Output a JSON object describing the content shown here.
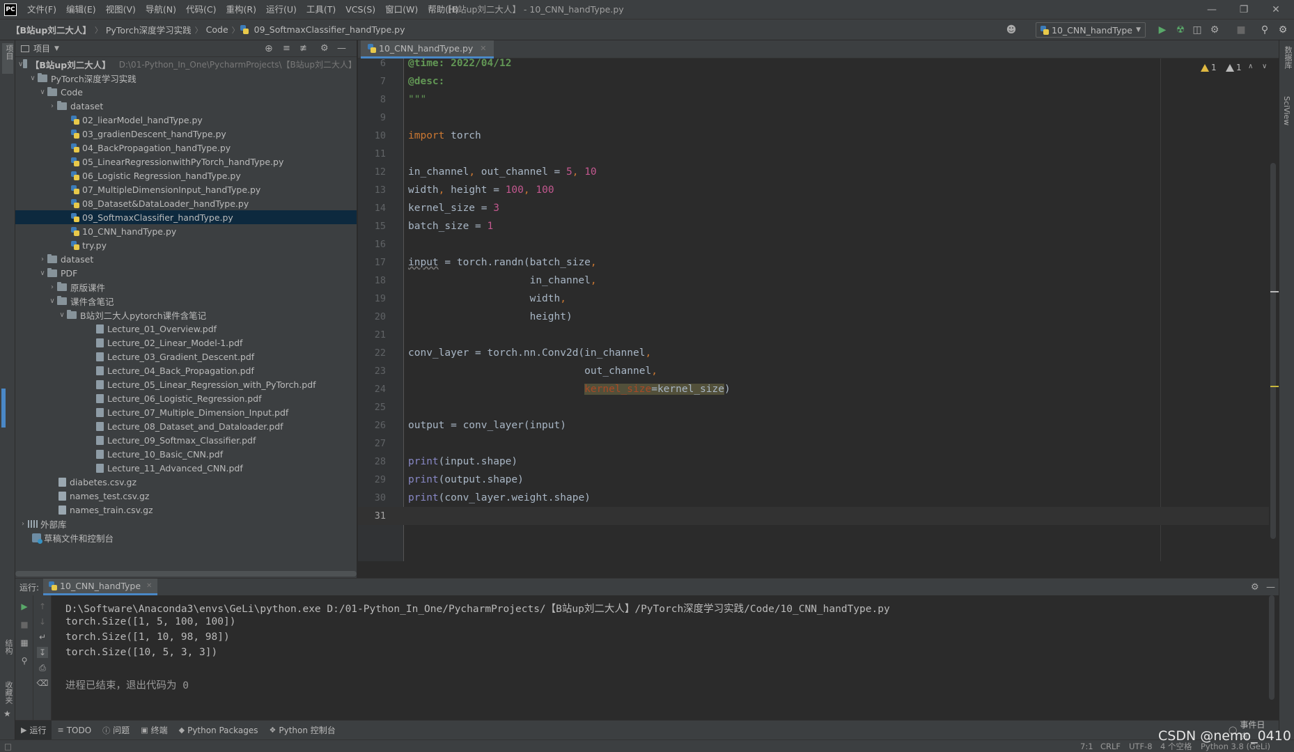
{
  "menubar": {
    "logo": "PC",
    "items": [
      "文件(F)",
      "编辑(E)",
      "视图(V)",
      "导航(N)",
      "代码(C)",
      "重构(R)",
      "运行(U)",
      "工具(T)",
      "VCS(S)",
      "窗口(W)",
      "帮助(H)"
    ],
    "window_title": "【B站up刘二大人】 - 10_CNN_handType.py"
  },
  "navbar": {
    "breadcrumbs": [
      "【B站up刘二大人】",
      "PyTorch深度学习实践",
      "Code",
      "09_SoftmaxClassifier_handType.py"
    ],
    "run_config": "10_CNN_handType"
  },
  "left_strip": {
    "project_label": "项目",
    "structure_label": "结构",
    "favorites_label": "收藏夹"
  },
  "right_strip": {
    "database_label": "数据库",
    "sciview_label": "SciView"
  },
  "project": {
    "header": "项目",
    "root": {
      "name": "【B站up刘二大人】",
      "path": "D:\\01-Python_In_One\\PycharmProjects\\【B站up刘二大人】"
    },
    "items": [
      {
        "label": "PyTorch深度学习实践"
      },
      {
        "label": "Code"
      },
      {
        "label": "dataset"
      },
      {
        "label": "02_liearModel_handType.py"
      },
      {
        "label": "03_gradienDescent_handType.py"
      },
      {
        "label": "04_BackPropagation_handType.py"
      },
      {
        "label": "05_LinearRegressionwithPyTorch_handType.py"
      },
      {
        "label": "06_Logistic Regression_handType.py"
      },
      {
        "label": "07_MultipleDimensionInput_handType.py"
      },
      {
        "label": "08_Dataset&DataLoader_handType.py"
      },
      {
        "label": "09_SoftmaxClassifier_handType.py"
      },
      {
        "label": "10_CNN_handType.py"
      },
      {
        "label": "try.py"
      },
      {
        "label": "dataset"
      },
      {
        "label": "PDF"
      },
      {
        "label": "原版课件"
      },
      {
        "label": "课件含笔记"
      },
      {
        "label": "B站刘二大人pytorch课件含笔记"
      },
      {
        "label": "Lecture_01_Overview.pdf"
      },
      {
        "label": "Lecture_02_Linear_Model-1.pdf"
      },
      {
        "label": "Lecture_03_Gradient_Descent.pdf"
      },
      {
        "label": "Lecture_04_Back_Propagation.pdf"
      },
      {
        "label": "Lecture_05_Linear_Regression_with_PyTorch.pdf"
      },
      {
        "label": "Lecture_06_Logistic_Regression.pdf"
      },
      {
        "label": "Lecture_07_Multiple_Dimension_Input.pdf"
      },
      {
        "label": "Lecture_08_Dataset_and_Dataloader.pdf"
      },
      {
        "label": "Lecture_09_Softmax_Classifier.pdf"
      },
      {
        "label": "Lecture_10_Basic_CNN.pdf"
      },
      {
        "label": "Lecture_11_Advanced_CNN.pdf"
      },
      {
        "label": "diabetes.csv.gz"
      },
      {
        "label": "names_test.csv.gz"
      },
      {
        "label": "names_train.csv.gz"
      },
      {
        "label": "外部库"
      },
      {
        "label": "草稿文件和控制台"
      }
    ]
  },
  "editor": {
    "tab": "10_CNN_handType.py",
    "warnings": {
      "count_a": "1",
      "count_b": "1"
    },
    "line_numbers": [
      "6",
      "7",
      "8",
      "9",
      "10",
      "11",
      "12",
      "13",
      "14",
      "15",
      "16",
      "17",
      "18",
      "19",
      "20",
      "21",
      "22",
      "23",
      "24",
      "25",
      "26",
      "27",
      "28",
      "29",
      "30",
      "31"
    ],
    "code": {
      "l6_tag": "@time:",
      "l6_val": " 2022/04/12",
      "l7_tag": "@desc:",
      "l8": "\"\"\"",
      "l10_kw": "import",
      "l10_rest": " torch",
      "l12_a": "in_channel",
      "l12_c1": ", ",
      "l12_b": "out_channel = ",
      "l12_n1": "5",
      "l12_c2": ", ",
      "l12_n2": "10",
      "l13_a": "width",
      "l13_c1": ", ",
      "l13_b": "height = ",
      "l13_n1": "100",
      "l13_c2": ", ",
      "l13_n2": "100",
      "l14_a": "kernel_size = ",
      "l14_n": "3",
      "l15_a": "batch_size = ",
      "l15_n": "1",
      "l17_a": "input",
      "l17_b": " = torch.randn(batch_size",
      "l17_c": ",",
      "l18_a": "                    in_channel",
      "l18_c": ",",
      "l19_a": "                    width",
      "l19_c": ",",
      "l20_a": "                    height)",
      "l22_a": "conv_layer = torch.nn.Conv2d(in_channel",
      "l22_c": ",",
      "l23_a": "                             out_channel",
      "l23_c": ",",
      "l24_pad": "                             ",
      "l24_kw": "kernel_size",
      "l24_eq": "=",
      "l24_val": "kernel_size",
      "l24_close": ")",
      "l26": "output = conv_layer(input)",
      "l28_fn": "print",
      "l28_rest": "(input.shape)",
      "l29_fn": "print",
      "l29_rest": "(output.shape)",
      "l30_fn": "print",
      "l30_rest": "(conv_layer.weight.shape)"
    }
  },
  "run": {
    "label": "运行:",
    "tab": "10_CNN_handType",
    "output": [
      "D:\\Software\\Anaconda3\\envs\\GeLi\\python.exe D:/01-Python_In_One/PycharmProjects/【B站up刘二大人】/PyTorch深度学习实践/Code/10_CNN_handType.py",
      "torch.Size([1, 5, 100, 100])",
      "torch.Size([1, 10, 98, 98])",
      "torch.Size([10, 5, 3, 3])",
      "",
      "进程已结束，退出代码为 0"
    ]
  },
  "toolwindows": [
    "运行",
    "TODO",
    "问题",
    "终端",
    "Python Packages",
    "Python 控制台"
  ],
  "status": {
    "position": "7:1",
    "line_sep": "CRLF",
    "encoding": "UTF-8",
    "indent": "4 个空格",
    "interpreter": "Python 3.8 (GeLi)",
    "event_log": "事件日志"
  },
  "watermark": "CSDN @nemo_0410"
}
